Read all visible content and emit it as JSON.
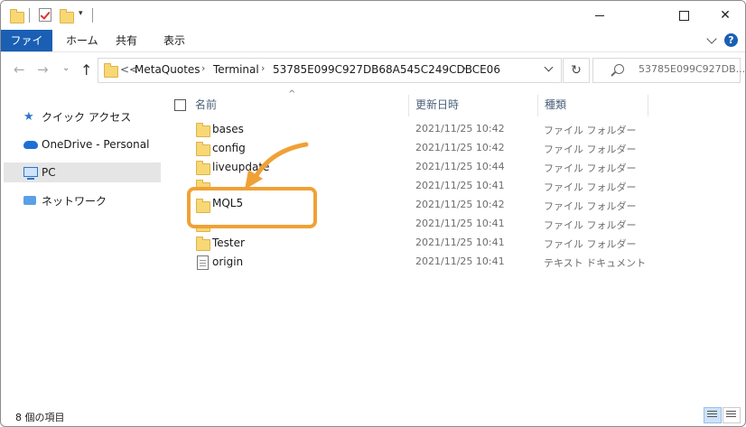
{
  "window": {
    "controls": {
      "minimize": "—",
      "maximize": "□",
      "close": "✕"
    }
  },
  "ribbon": {
    "tabs": [
      "ファイル",
      "ホーム",
      "共有",
      "表示"
    ],
    "help": "?"
  },
  "address": {
    "prefix": "<<",
    "crumbs": [
      "MetaQuotes",
      "Terminal",
      "53785E099C927DB68A545C249CDBCE06"
    ],
    "refresh": "↻",
    "search_placeholder": "53785E099C927DB..."
  },
  "nav": {
    "items": [
      {
        "label": "クイック アクセス",
        "icon": "quick-access-star-icon"
      },
      {
        "label": "OneDrive - Personal",
        "icon": "onedrive-cloud-icon"
      },
      {
        "label": "PC",
        "icon": "pc-icon",
        "selected": true
      },
      {
        "label": "ネットワーク",
        "icon": "network-icon"
      }
    ]
  },
  "columns": {
    "name": "名前",
    "date": "更新日時",
    "type": "種類"
  },
  "files": [
    {
      "name": "bases",
      "date": "2021/11/25 10:42",
      "type": "ファイル フォルダー",
      "icon": "folder-icon"
    },
    {
      "name": "config",
      "date": "2021/11/25 10:42",
      "type": "ファイル フォルダー",
      "icon": "folder-icon"
    },
    {
      "name": "liveupdate",
      "date": "2021/11/25 10:44",
      "type": "ファイル フォルダー",
      "icon": "folder-icon"
    },
    {
      "name": "",
      "date": "2021/11/25 10:41",
      "type": "ファイル フォルダー",
      "icon": "folder-icon"
    },
    {
      "name": "MQL5",
      "date": "2021/11/25 10:42",
      "type": "ファイル フォルダー",
      "icon": "folder-icon"
    },
    {
      "name": "",
      "date": "2021/11/25 10:41",
      "type": "ファイル フォルダー",
      "icon": "folder-icon"
    },
    {
      "name": "Tester",
      "date": "2021/11/25 10:41",
      "type": "ファイル フォルダー",
      "icon": "folder-icon"
    },
    {
      "name": "origin",
      "date": "2021/11/25 10:41",
      "type": "テキスト ドキュメント",
      "icon": "text-file-icon"
    }
  ],
  "status": {
    "count": "8 個の項目"
  },
  "colors": {
    "accent": "#1a5fb4",
    "highlight": "#f0a136"
  }
}
